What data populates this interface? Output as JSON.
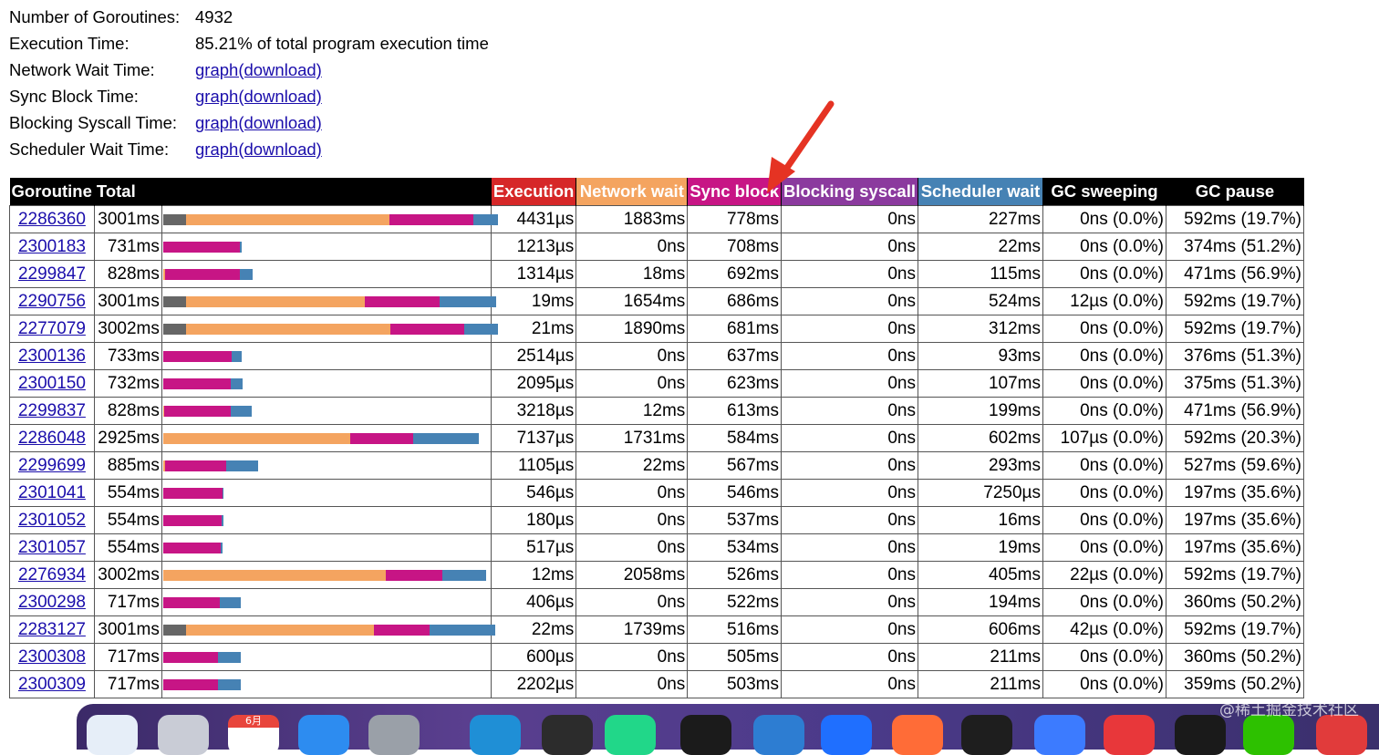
{
  "summary": {
    "goroutines_label": "Number of Goroutines:",
    "goroutines_value": "4932",
    "exec_label": "Execution Time:",
    "exec_value": "85.21% of total program execution time",
    "network_label": "Network Wait Time:",
    "sync_label": "Sync Block Time:",
    "syscall_label": "Blocking Syscall Time:",
    "sched_label": "Scheduler Wait Time:",
    "link_text": "graph(download)"
  },
  "table": {
    "headers": {
      "goroutine": "Goroutine",
      "total": "Total",
      "execution": "Execution",
      "network": "Network wait",
      "sync": "Sync block",
      "syscall": "Blocking syscall",
      "sched": "Scheduler wait",
      "sweep": "GC sweeping",
      "pause": "GC pause"
    },
    "colors": {
      "execution": "#d62728",
      "network": "#f4a460",
      "sync": "#c71585",
      "syscall": "#8b3a9e",
      "sched": "#4682b4",
      "gc": "#666666",
      "black": "#000000"
    },
    "rows": [
      {
        "id": "2286360",
        "total": "3001ms",
        "exec": "4431µs",
        "net": "1883ms",
        "sync": "778ms",
        "sys": "0ns",
        "sched": "227ms",
        "sweep": "0ns (0.0%)",
        "pause": "592ms (19.7%)",
        "gc_f": 0.197,
        "net_f": 0.627,
        "sync_f": 0.259,
        "sched_f": 0.076
      },
      {
        "id": "2300183",
        "total": "731ms",
        "exec": "1213µs",
        "net": "0ns",
        "sync": "708ms",
        "sys": "0ns",
        "sched": "22ms",
        "sweep": "0ns (0.0%)",
        "pause": "374ms (51.2%)",
        "gc_f": 0,
        "net_f": 0,
        "sync_f": 0.236,
        "sched_f": 0.007
      },
      {
        "id": "2299847",
        "total": "828ms",
        "exec": "1314µs",
        "net": "18ms",
        "sync": "692ms",
        "sys": "0ns",
        "sched": "115ms",
        "sweep": "0ns (0.0%)",
        "pause": "471ms (56.9%)",
        "gc_f": 0,
        "net_f": 0.006,
        "sync_f": 0.231,
        "sched_f": 0.038
      },
      {
        "id": "2290756",
        "total": "3001ms",
        "exec": "19ms",
        "net": "1654ms",
        "sync": "686ms",
        "sys": "0ns",
        "sched": "524ms",
        "sweep": "12µs (0.0%)",
        "pause": "592ms (19.7%)",
        "gc_f": 0.197,
        "net_f": 0.551,
        "sync_f": 0.229,
        "sched_f": 0.175
      },
      {
        "id": "2277079",
        "total": "3002ms",
        "exec": "21ms",
        "net": "1890ms",
        "sync": "681ms",
        "sys": "0ns",
        "sched": "312ms",
        "sweep": "0ns (0.0%)",
        "pause": "592ms (19.7%)",
        "gc_f": 0.197,
        "net_f": 0.63,
        "sync_f": 0.227,
        "sched_f": 0.104
      },
      {
        "id": "2300136",
        "total": "733ms",
        "exec": "2514µs",
        "net": "0ns",
        "sync": "637ms",
        "sys": "0ns",
        "sched": "93ms",
        "sweep": "0ns (0.0%)",
        "pause": "376ms (51.3%)",
        "gc_f": 0,
        "net_f": 0,
        "sync_f": 0.212,
        "sched_f": 0.031
      },
      {
        "id": "2300150",
        "total": "732ms",
        "exec": "2095µs",
        "net": "0ns",
        "sync": "623ms",
        "sys": "0ns",
        "sched": "107ms",
        "sweep": "0ns (0.0%)",
        "pause": "375ms (51.3%)",
        "gc_f": 0,
        "net_f": 0,
        "sync_f": 0.208,
        "sched_f": 0.036
      },
      {
        "id": "2299837",
        "total": "828ms",
        "exec": "3218µs",
        "net": "12ms",
        "sync": "613ms",
        "sys": "0ns",
        "sched": "199ms",
        "sweep": "0ns (0.0%)",
        "pause": "471ms (56.9%)",
        "gc_f": 0,
        "net_f": 0.004,
        "sync_f": 0.204,
        "sched_f": 0.066
      },
      {
        "id": "2286048",
        "total": "2925ms",
        "exec": "7137µs",
        "net": "1731ms",
        "sync": "584ms",
        "sys": "0ns",
        "sched": "602ms",
        "sweep": "107µs (0.0%)",
        "pause": "592ms (20.3%)",
        "gc_f": 0,
        "net_f": 0.577,
        "sync_f": 0.195,
        "sched_f": 0.201
      },
      {
        "id": "2299699",
        "total": "885ms",
        "exec": "1105µs",
        "net": "22ms",
        "sync": "567ms",
        "sys": "0ns",
        "sched": "293ms",
        "sweep": "0ns (0.0%)",
        "pause": "527ms (59.6%)",
        "gc_f": 0,
        "net_f": 0.007,
        "sync_f": 0.189,
        "sched_f": 0.098
      },
      {
        "id": "2301041",
        "total": "554ms",
        "exec": "546µs",
        "net": "0ns",
        "sync": "546ms",
        "sys": "0ns",
        "sched": "7250µs",
        "sweep": "0ns (0.0%)",
        "pause": "197ms (35.6%)",
        "gc_f": 0,
        "net_f": 0,
        "sync_f": 0.182,
        "sched_f": 0.002
      },
      {
        "id": "2301052",
        "total": "554ms",
        "exec": "180µs",
        "net": "0ns",
        "sync": "537ms",
        "sys": "0ns",
        "sched": "16ms",
        "sweep": "0ns (0.0%)",
        "pause": "197ms (35.6%)",
        "gc_f": 0,
        "net_f": 0,
        "sync_f": 0.179,
        "sched_f": 0.005
      },
      {
        "id": "2301057",
        "total": "554ms",
        "exec": "517µs",
        "net": "0ns",
        "sync": "534ms",
        "sys": "0ns",
        "sched": "19ms",
        "sweep": "0ns (0.0%)",
        "pause": "197ms (35.6%)",
        "gc_f": 0,
        "net_f": 0,
        "sync_f": 0.178,
        "sched_f": 0.006
      },
      {
        "id": "2276934",
        "total": "3002ms",
        "exec": "12ms",
        "net": "2058ms",
        "sync": "526ms",
        "sys": "0ns",
        "sched": "405ms",
        "sweep": "22µs (0.0%)",
        "pause": "592ms (19.7%)",
        "gc_f": 0,
        "net_f": 0.686,
        "sync_f": 0.175,
        "sched_f": 0.135
      },
      {
        "id": "2300298",
        "total": "717ms",
        "exec": "406µs",
        "net": "0ns",
        "sync": "522ms",
        "sys": "0ns",
        "sched": "194ms",
        "sweep": "0ns (0.0%)",
        "pause": "360ms (50.2%)",
        "gc_f": 0,
        "net_f": 0,
        "sync_f": 0.174,
        "sched_f": 0.065
      },
      {
        "id": "2283127",
        "total": "3001ms",
        "exec": "22ms",
        "net": "1739ms",
        "sync": "516ms",
        "sys": "0ns",
        "sched": "606ms",
        "sweep": "42µs (0.0%)",
        "pause": "592ms (19.7%)",
        "gc_f": 0.197,
        "net_f": 0.58,
        "sync_f": 0.172,
        "sched_f": 0.202
      },
      {
        "id": "2300308",
        "total": "717ms",
        "exec": "600µs",
        "net": "0ns",
        "sync": "505ms",
        "sys": "0ns",
        "sched": "211ms",
        "sweep": "0ns (0.0%)",
        "pause": "360ms (50.2%)",
        "gc_f": 0,
        "net_f": 0,
        "sync_f": 0.168,
        "sched_f": 0.07
      },
      {
        "id": "2300309",
        "total": "717ms",
        "exec": "2202µs",
        "net": "0ns",
        "sync": "503ms",
        "sys": "0ns",
        "sched": "211ms",
        "sweep": "0ns (0.0%)",
        "pause": "359ms (50.2%)",
        "gc_f": 0,
        "net_f": 0,
        "sync_f": 0.168,
        "sched_f": 0.07
      }
    ]
  },
  "annotation": {
    "arrow_color": "#e53323"
  },
  "dock": {
    "month_label": "6月",
    "icons": [
      "finder-icon",
      "launchpad-icon",
      "calendar-icon",
      "xcode-icon",
      "system-settings-icon",
      "edge-icon",
      "terminal-icon",
      "datagrip-icon",
      "iterm-beta-icon",
      "vscode-icon",
      "messenger-icon",
      "postman-icon",
      "activity-monitor-icon",
      "lark-icon",
      "office-icon",
      "goland-icon",
      "wechat-icon",
      "wps-icon"
    ]
  },
  "watermark": "@稀土掘金技术社区"
}
